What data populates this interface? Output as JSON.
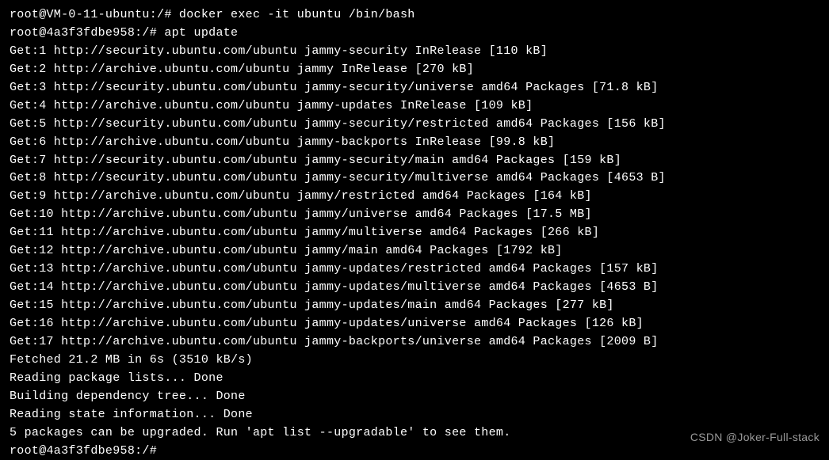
{
  "terminal": {
    "lines": [
      "root@VM-0-11-ubuntu:/# docker exec -it ubuntu /bin/bash",
      "root@4a3f3fdbe958:/# apt update",
      "Get:1 http://security.ubuntu.com/ubuntu jammy-security InRelease [110 kB]",
      "Get:2 http://archive.ubuntu.com/ubuntu jammy InRelease [270 kB]",
      "Get:3 http://security.ubuntu.com/ubuntu jammy-security/universe amd64 Packages [71.8 kB]",
      "Get:4 http://archive.ubuntu.com/ubuntu jammy-updates InRelease [109 kB]",
      "Get:5 http://security.ubuntu.com/ubuntu jammy-security/restricted amd64 Packages [156 kB]",
      "Get:6 http://archive.ubuntu.com/ubuntu jammy-backports InRelease [99.8 kB]",
      "Get:7 http://security.ubuntu.com/ubuntu jammy-security/main amd64 Packages [159 kB]",
      "Get:8 http://security.ubuntu.com/ubuntu jammy-security/multiverse amd64 Packages [4653 B]",
      "Get:9 http://archive.ubuntu.com/ubuntu jammy/restricted amd64 Packages [164 kB]",
      "Get:10 http://archive.ubuntu.com/ubuntu jammy/universe amd64 Packages [17.5 MB]",
      "Get:11 http://archive.ubuntu.com/ubuntu jammy/multiverse amd64 Packages [266 kB]",
      "Get:12 http://archive.ubuntu.com/ubuntu jammy/main amd64 Packages [1792 kB]",
      "Get:13 http://archive.ubuntu.com/ubuntu jammy-updates/restricted amd64 Packages [157 kB]",
      "Get:14 http://archive.ubuntu.com/ubuntu jammy-updates/multiverse amd64 Packages [4653 B]",
      "Get:15 http://archive.ubuntu.com/ubuntu jammy-updates/main amd64 Packages [277 kB]",
      "Get:16 http://archive.ubuntu.com/ubuntu jammy-updates/universe amd64 Packages [126 kB]",
      "Get:17 http://archive.ubuntu.com/ubuntu jammy-backports/universe amd64 Packages [2009 B]",
      "Fetched 21.2 MB in 6s (3510 kB/s)",
      "Reading package lists... Done",
      "Building dependency tree... Done",
      "Reading state information... Done",
      "5 packages can be upgraded. Run 'apt list --upgradable' to see them.",
      "root@4a3f3fdbe958:/#"
    ]
  },
  "watermark": "CSDN @Joker-Full-stack"
}
